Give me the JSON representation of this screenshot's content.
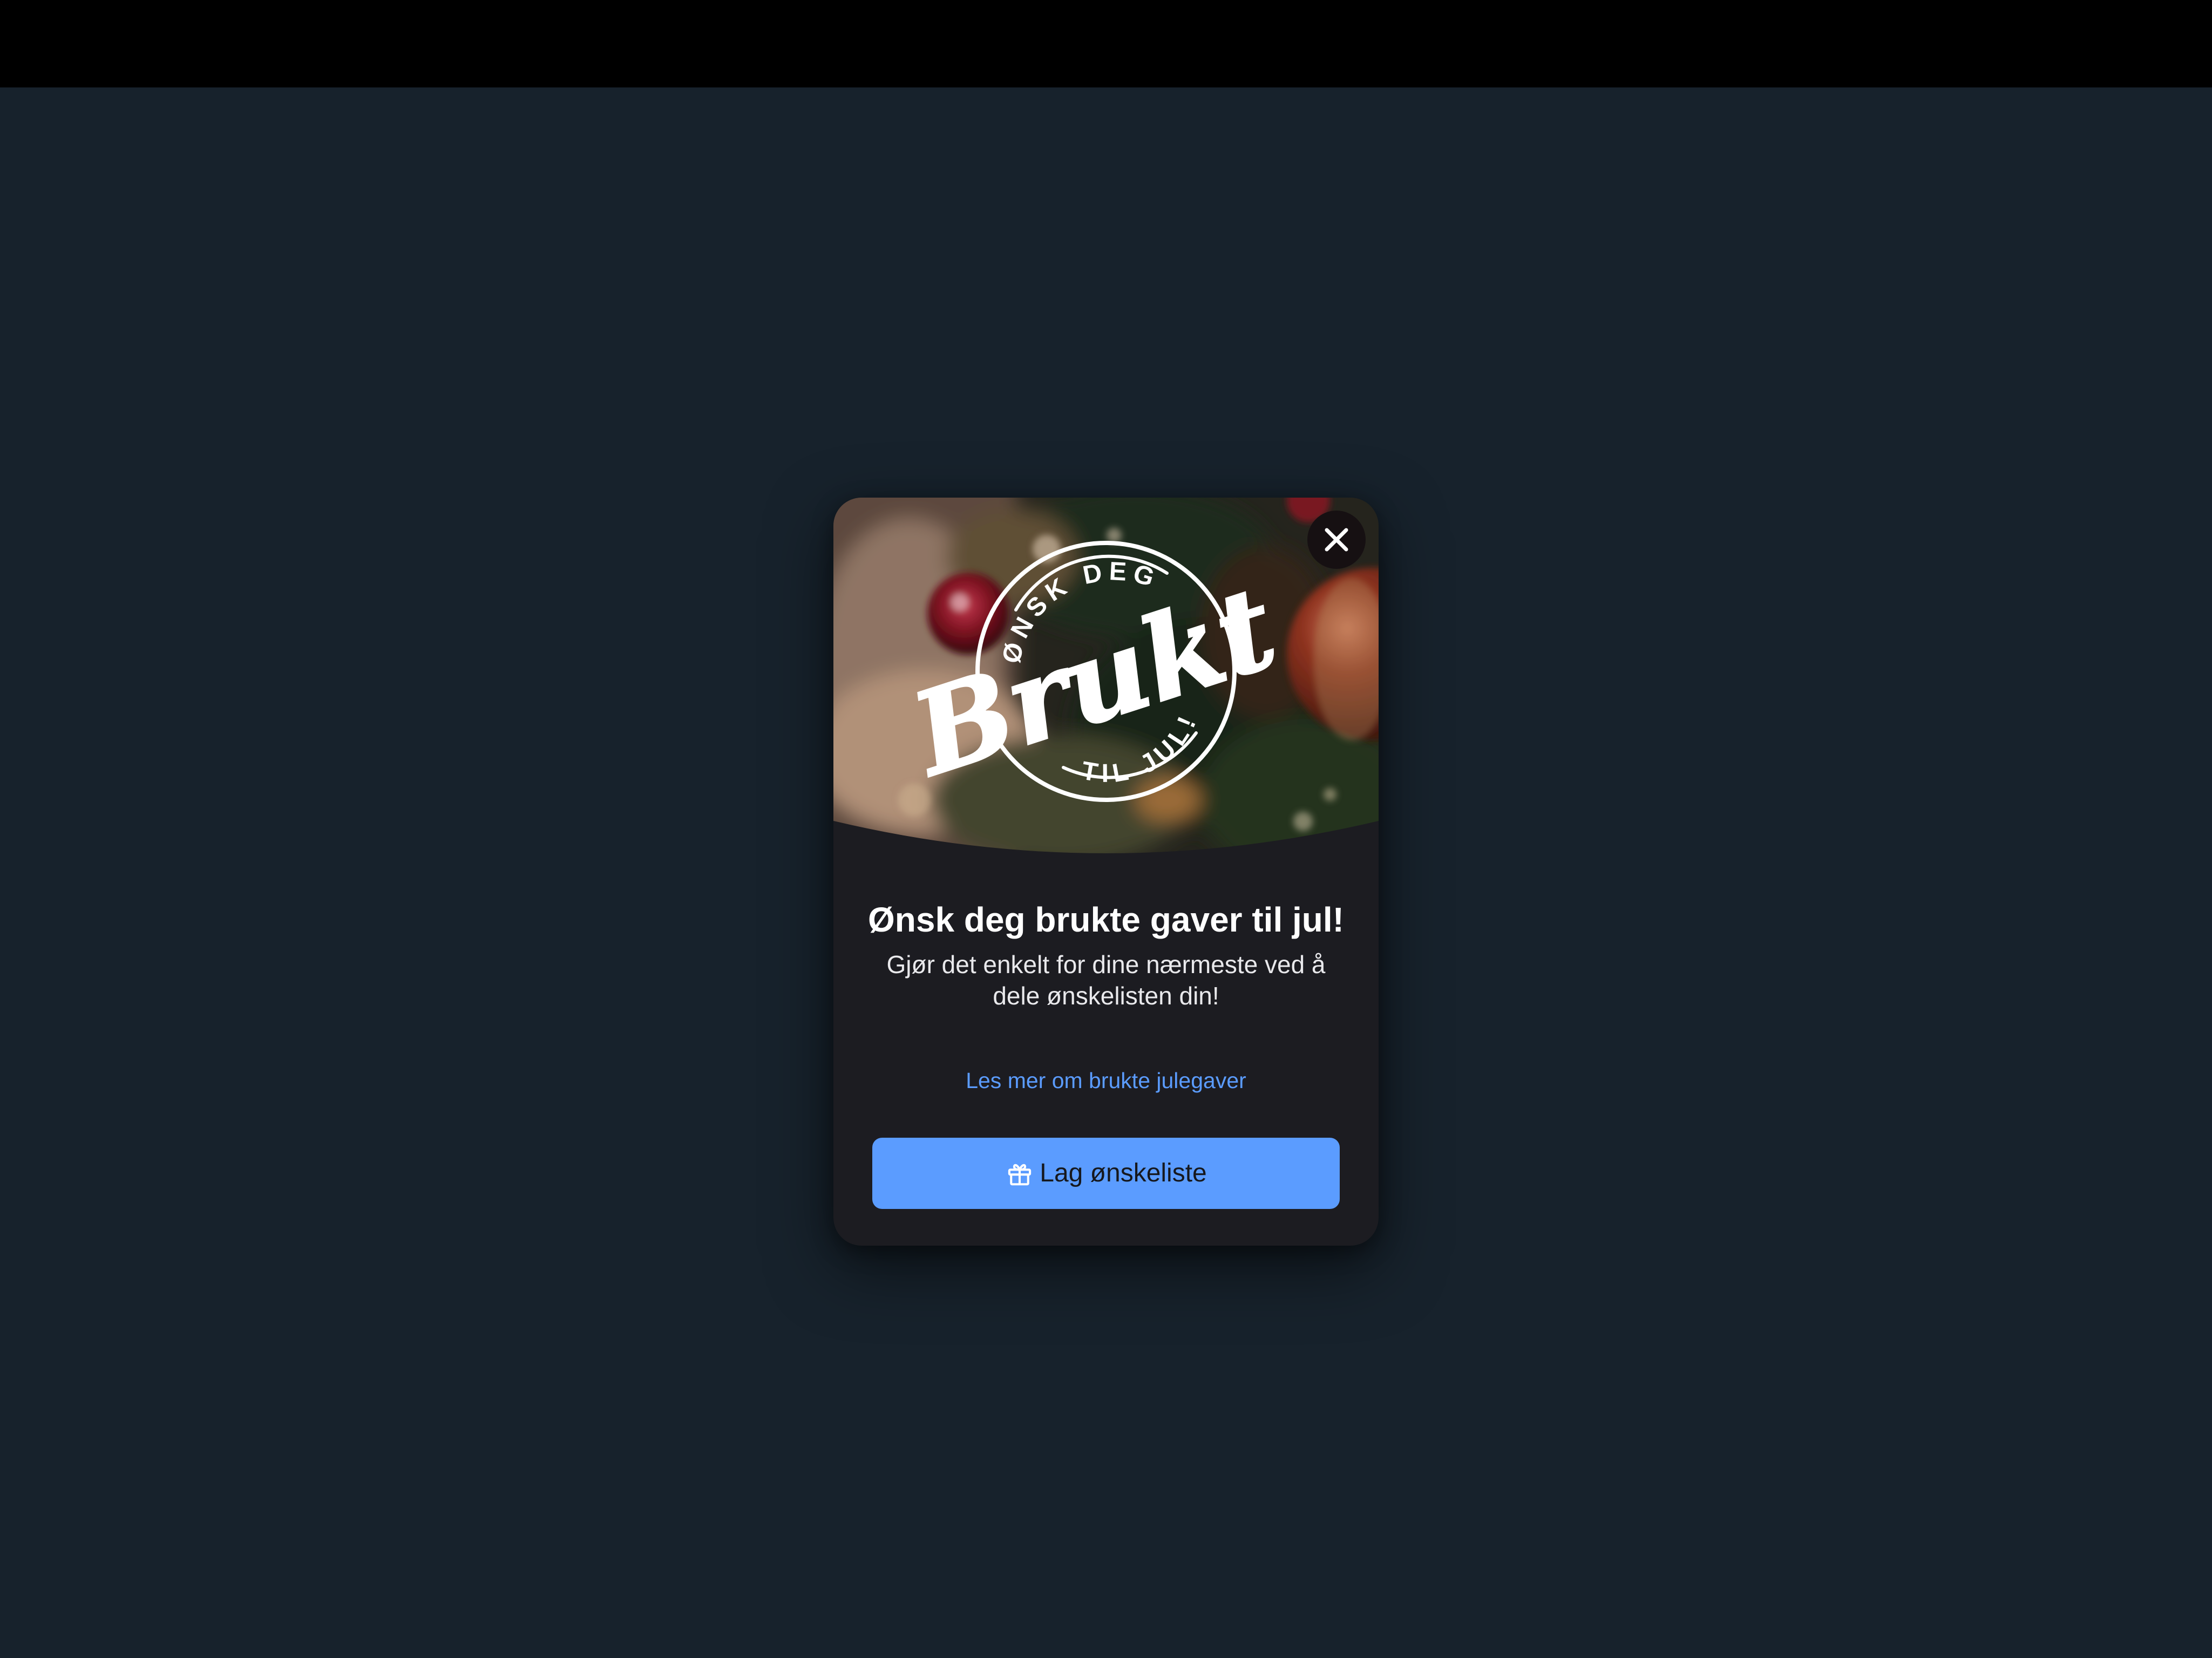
{
  "hero": {
    "badge_top_text": "ØNSK DEG",
    "badge_script_text": "Brukt",
    "badge_bottom_text": "TIL JUL!"
  },
  "close_button": {
    "icon": "close-icon"
  },
  "modal": {
    "title": "Ønsk deg brukte gaver til jul!",
    "subtitle_line1": "Gjør det enkelt for dine nærmeste ved å",
    "subtitle_line2": "dele ønskelisten din!",
    "link_label": "Les mer om brukte julegaver",
    "cta_label": "Lag ønskeliste",
    "cta_icon": "gift-icon"
  },
  "colors": {
    "backdrop": "#17222c",
    "modal_bg": "#1c1c21",
    "accent": "#5b9cff"
  }
}
